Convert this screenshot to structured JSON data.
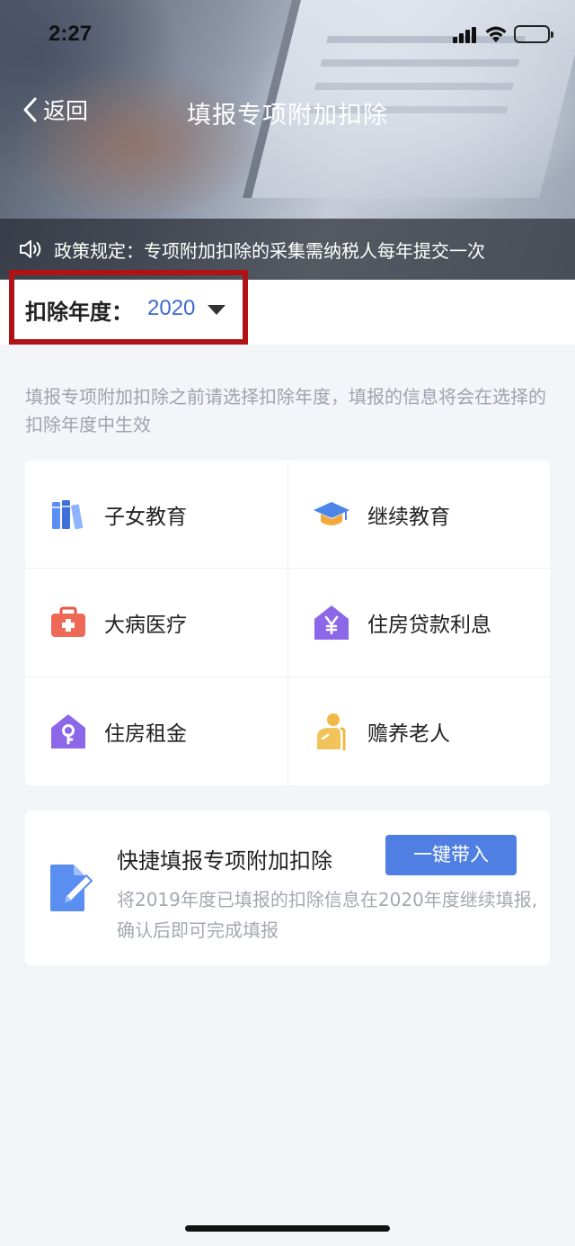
{
  "status_bar": {
    "time": "2:27"
  },
  "nav": {
    "back_label": "返回",
    "title": "填报专项附加扣除"
  },
  "notice": {
    "text": "政策规定：专项附加扣除的采集需纳税人每年提交一次"
  },
  "year": {
    "label": "扣除年度：",
    "value": "2020"
  },
  "hint": "填报专项附加扣除之前请选择扣除年度，填报的信息将会在选择的扣除年度中生效",
  "categories": [
    {
      "label": "子女教育",
      "icon": "books-icon"
    },
    {
      "label": "继续教育",
      "icon": "graduation-cap-icon"
    },
    {
      "label": "大病医疗",
      "icon": "medical-kit-icon"
    },
    {
      "label": "住房贷款利息",
      "icon": "house-yen-icon"
    },
    {
      "label": "住房租金",
      "icon": "house-key-icon"
    },
    {
      "label": "赡养老人",
      "icon": "elderly-person-icon"
    }
  ],
  "quick_fill": {
    "title": "快捷填报专项附加扣除",
    "button": "一键带入",
    "description": "将2019年度已填报的扣除信息在2020年度继续填报,确认后即可完成填报",
    "icon": "document-edit-icon"
  },
  "colors": {
    "accent": "#3e6bd1",
    "button": "#4f7fe2",
    "highlight_border": "#b01216"
  }
}
